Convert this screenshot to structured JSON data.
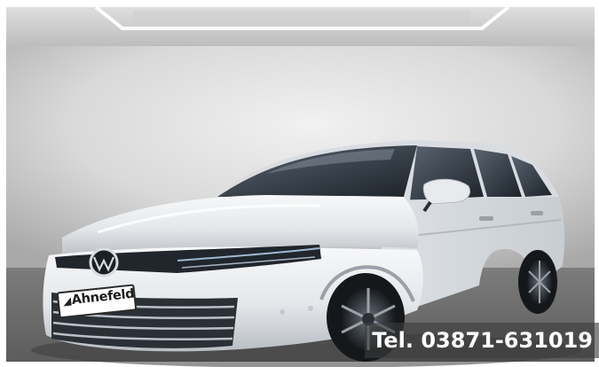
{
  "image": {
    "subject": "white station wagon in showroom",
    "dealer_plate": {
      "text": "Ahnefeld",
      "logo_glyph": "◢"
    },
    "overlay_text": "Tel. 03871-631019",
    "colors": {
      "wall": "#dcdcdc",
      "floor": "#6f6f6f",
      "car_body": "#e9ecef",
      "overlay_bg": "#3c3c3c",
      "overlay_text": "#ffffff"
    }
  }
}
